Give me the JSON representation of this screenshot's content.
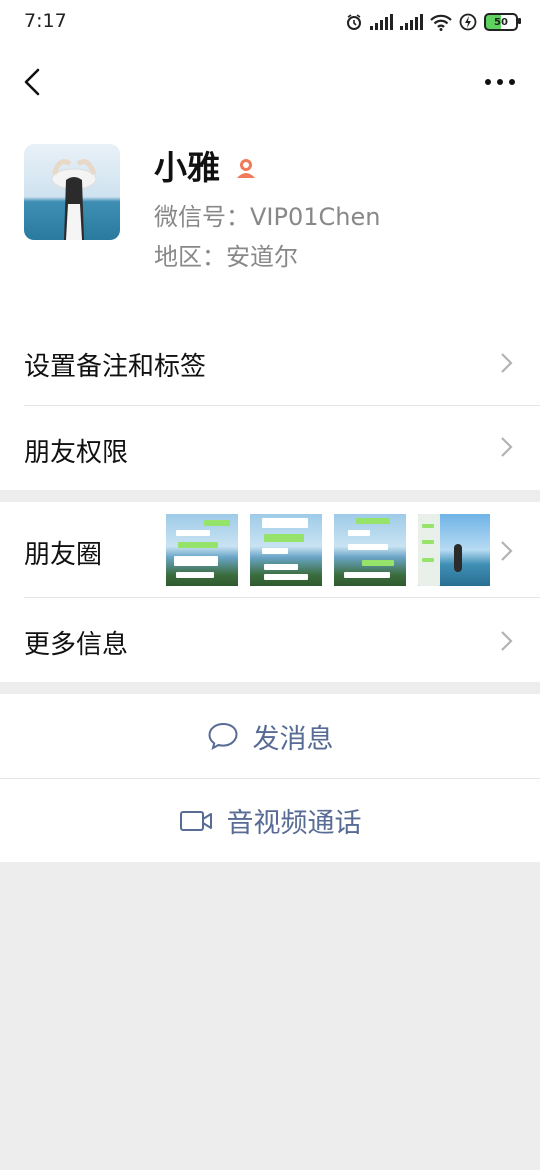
{
  "status_bar": {
    "time": "7:17",
    "battery": "50",
    "icons": [
      "alarm-icon",
      "signal-icon",
      "signal-icon",
      "wifi-icon",
      "charging-icon",
      "battery-icon"
    ]
  },
  "nav": {
    "back_icon": "back-chevron-icon",
    "more_icon": "more-dots-icon"
  },
  "profile": {
    "name": "小雅",
    "wechat_id": "微信号：VIP01Chen",
    "region": "地区：安道尔",
    "gender_icon": "female-icon"
  },
  "menu": {
    "remark_tags": "设置备注和标签",
    "permissions": "朋友权限",
    "moments": "朋友圈",
    "more_info": "更多信息"
  },
  "actions": {
    "send_message": "发消息",
    "video_call": "音视频通话"
  },
  "colors": {
    "link_blue": "#576b95",
    "background_gray": "#ededed",
    "gender_icon": "#f07b5a"
  }
}
